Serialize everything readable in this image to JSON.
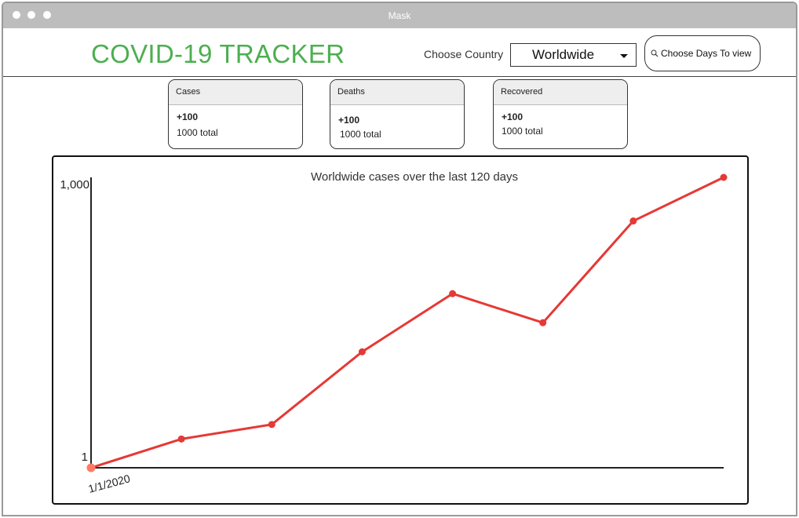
{
  "window": {
    "title": "Mask"
  },
  "header": {
    "app_title": "COVID-19 TRACKER",
    "country_label": "Choose Country",
    "country_selected": "Worldwide",
    "days_button_label": "Choose Days  To view"
  },
  "cards": [
    {
      "title": "Cases",
      "delta": "+100",
      "total": "1000 total"
    },
    {
      "title": "Deaths",
      "delta": "+100",
      "total": "1000 total"
    },
    {
      "title": "Recovered",
      "delta": "+100",
      "total": "1000 total"
    }
  ],
  "colors": {
    "accent": "#4caf50",
    "line": "#e53935",
    "first_point": "#ff7a66"
  },
  "chart_data": {
    "type": "line",
    "title": "Worldwide cases over the last 120 days",
    "y_tick_labels": [
      "1,000",
      "1"
    ],
    "x_tick_labels": [
      "1/1/2020"
    ],
    "ylim": [
      1,
      1000
    ],
    "x": [
      0,
      1,
      2,
      3,
      4,
      5,
      6,
      7
    ],
    "values": [
      1,
      100,
      150,
      400,
      600,
      500,
      850,
      1000
    ],
    "grid": false,
    "legend": "none"
  }
}
